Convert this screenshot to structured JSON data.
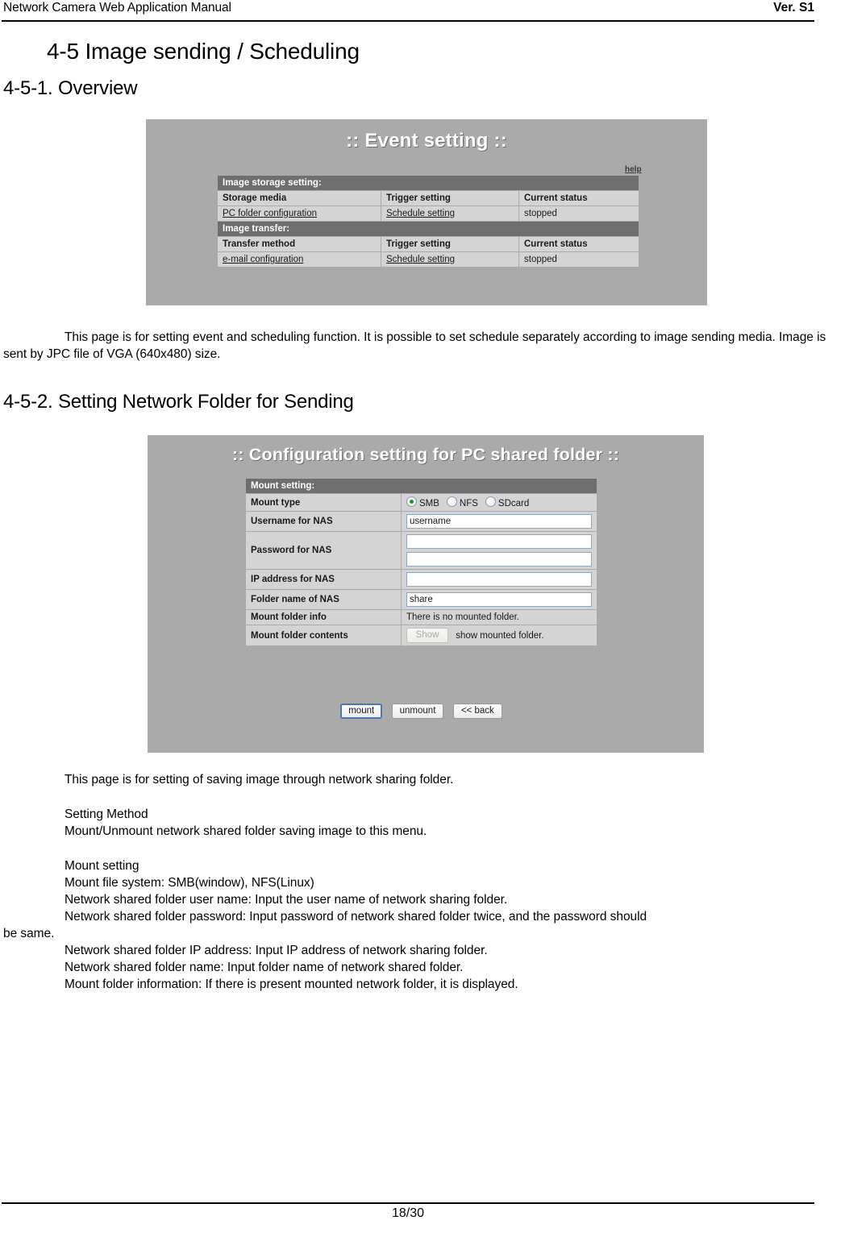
{
  "header": {
    "left_title": "Network Camera Web Application Manual",
    "right_version": "Ver. S1"
  },
  "headings": {
    "section": "4-5   Image sending / Scheduling",
    "sub_1": "4-5-1.   Overview",
    "sub_2": "4-5-2.   Setting Network Folder for Sending"
  },
  "screenshot_event": {
    "title": ":: Event setting ::",
    "help_label": "help",
    "group_storage": "Image storage setting:",
    "storage_headers": [
      "Storage media",
      "Trigger setting",
      "Current status"
    ],
    "storage_row": [
      "PC folder configuration",
      "Schedule setting",
      "stopped"
    ],
    "group_transfer": "Image transfer:",
    "transfer_headers": [
      "Transfer method",
      "Trigger setting",
      "Current status"
    ],
    "transfer_row": [
      "e-mail configuration",
      "Schedule setting",
      "stopped"
    ]
  },
  "paragraph_overview": "This page is for setting event and scheduling function.   It is possible to set schedule separately according to image sending media. Image is sent by JPC file of VGA (640x480) size.",
  "screenshot_folder": {
    "title": ":: Configuration setting for PC shared folder ::",
    "group_mount": "Mount setting:",
    "rows": {
      "mount_type_label": "Mount type",
      "mount_type_options": [
        "SMB",
        "NFS",
        "SDcard"
      ],
      "mount_type_selected": "SMB",
      "username_label": "Username for NAS",
      "username_value": "username",
      "password_label": "Password for NAS",
      "password_value_1": "",
      "password_value_2": "",
      "ip_label": "IP address for NAS",
      "ip_value": "",
      "folder_label": "Folder name of NAS",
      "folder_value": "share",
      "mount_info_label": "Mount folder info",
      "mount_info_value": "There is no mounted folder.",
      "mount_contents_label": "Mount folder contents",
      "mount_contents_button": "Show",
      "mount_contents_text": "show mounted folder."
    },
    "buttons": [
      "mount",
      "unmount",
      "<< back"
    ]
  },
  "body_text": {
    "line_1": "This page is for setting of saving image through network sharing folder.",
    "line_2": "Setting Method",
    "line_3": "Mount/Unmount network shared folder saving image to this menu.",
    "line_4": "Mount setting",
    "line_5": "Mount file system: SMB(window), NFS(Linux)",
    "line_6": "Network shared folder user name: Input the user name of network sharing folder.",
    "line_7": "Network shared folder password: Input password of network shared folder twice, and the password should",
    "line_7b": "be same.",
    "line_8": "Network shared folder IP address: Input IP address of network sharing folder.",
    "line_9": "Network shared folder name: Input folder name of network shared folder.",
    "line_10": "Mount folder information: If there is present mounted network folder, it is displayed."
  },
  "footer": {
    "page_number": "18/30"
  }
}
